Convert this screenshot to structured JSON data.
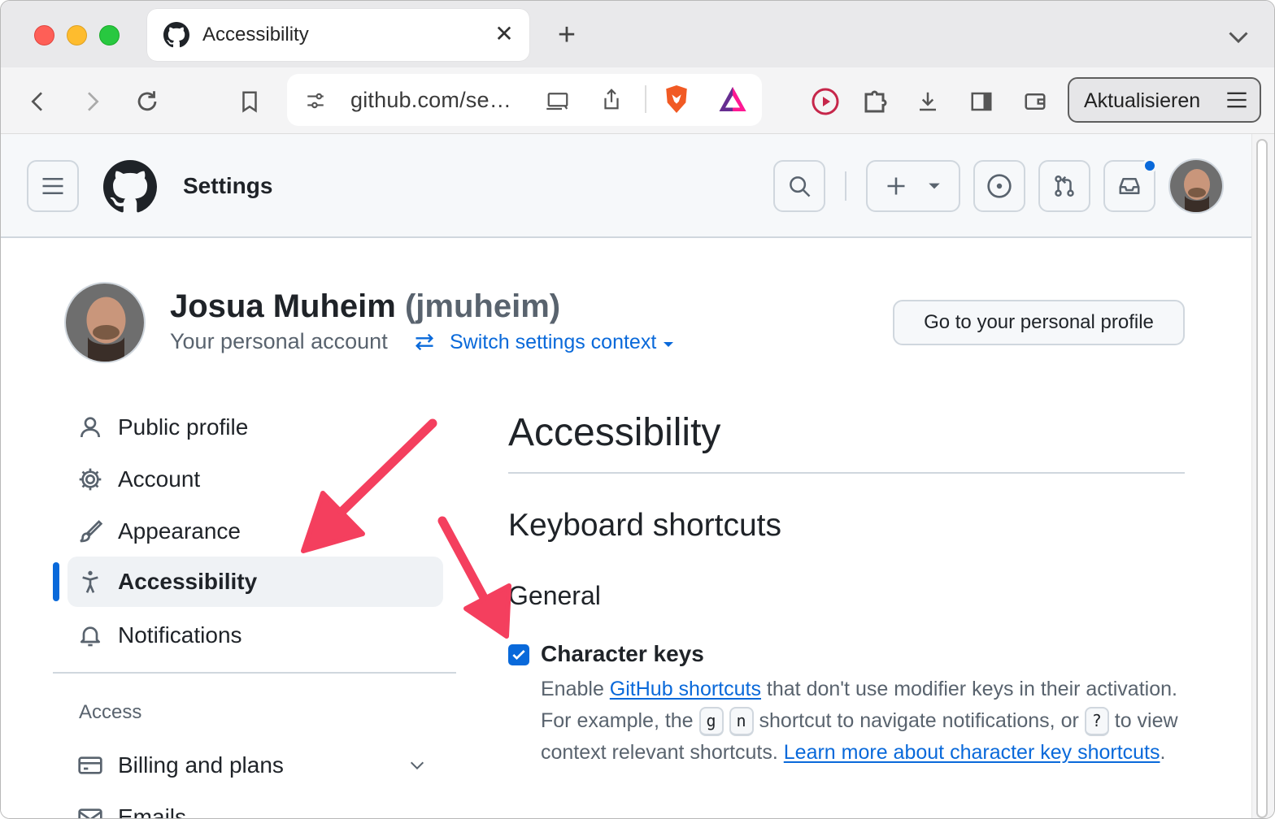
{
  "browser": {
    "tab_title": "Accessibility",
    "url": "github.com/se…",
    "update_button": "Aktualisieren"
  },
  "header": {
    "title": "Settings"
  },
  "profile": {
    "name": "Josua Muheim",
    "login": "(jmuheim)",
    "subtitle": "Your personal account",
    "switch_context": "Switch settings context",
    "goto_profile": "Go to your personal profile"
  },
  "sidebar": {
    "items": [
      {
        "label": "Public profile",
        "icon": "person-icon"
      },
      {
        "label": "Account",
        "icon": "gear-icon"
      },
      {
        "label": "Appearance",
        "icon": "paintbrush-icon"
      },
      {
        "label": "Accessibility",
        "icon": "accessibility-icon",
        "active": true
      },
      {
        "label": "Notifications",
        "icon": "bell-icon"
      }
    ],
    "section_heading": "Access",
    "access_items": [
      {
        "label": "Billing and plans",
        "icon": "credit-card-icon"
      },
      {
        "label": "Emails",
        "icon": "mail-icon"
      }
    ]
  },
  "main": {
    "title": "Accessibility",
    "section_title": "Keyboard shortcuts",
    "subsection_title": "General",
    "character_keys": {
      "label": "Character keys",
      "checked": true,
      "desc_1": "Enable ",
      "link_1": "GitHub shortcuts",
      "desc_2": " that don't use modifier keys in their activation. For example, the ",
      "kbd_g": "g",
      "kbd_n": "n",
      "desc_3": " shortcut to navigate notifications, or ",
      "kbd_q": "?",
      "desc_4": " to view context relevant shortcuts. ",
      "link_2": "Learn more about character key shortcuts",
      "desc_5": "."
    }
  },
  "colors": {
    "accent": "#0969da",
    "annotation_arrow": "#f43f5e"
  }
}
